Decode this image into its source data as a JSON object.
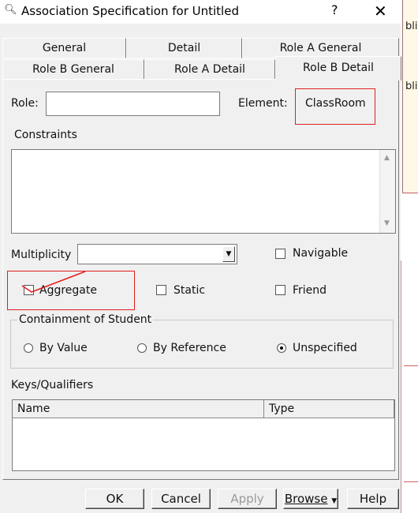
{
  "window": {
    "title": "Association Specification for Untitled",
    "help": "?",
    "close": "✕"
  },
  "tabs": {
    "row1": [
      "General",
      "Detail",
      "Role A General"
    ],
    "row2": [
      "Role B General",
      "Role A Detail",
      "Role B Detail"
    ],
    "active": "Role B Detail"
  },
  "role": {
    "label": "Role:",
    "value": ""
  },
  "element": {
    "label": "Element:",
    "value": "ClassRoom"
  },
  "constraints": {
    "label": "Constraints",
    "value": ""
  },
  "multiplicity": {
    "label": "Multiplicity",
    "value": ""
  },
  "checkboxes": {
    "navigable": {
      "label": "Navigable",
      "checked": false
    },
    "aggregate": {
      "label": "Aggregate",
      "checked": false
    },
    "static": {
      "label": "Static",
      "checked": false
    },
    "friend": {
      "label": "Friend",
      "checked": false
    }
  },
  "containment": {
    "title": "Containment of Student",
    "options": [
      "By Value",
      "By Reference",
      "Unspecified"
    ],
    "selected": "Unspecified"
  },
  "keys": {
    "label": "Keys/Qualifiers",
    "columns": [
      "Name",
      "Type"
    ],
    "rows": []
  },
  "buttons": {
    "ok": "OK",
    "cancel": "Cancel",
    "apply": "Apply",
    "browse": "Browse",
    "help": "Help"
  },
  "background": {
    "fragment": "bli"
  },
  "colors": {
    "annotation": "#e02020",
    "accent_yellow": "#fff8e6"
  },
  "icons": {
    "title": "magnifier-icon",
    "dropdown": "dropdown-arrow-icon"
  }
}
